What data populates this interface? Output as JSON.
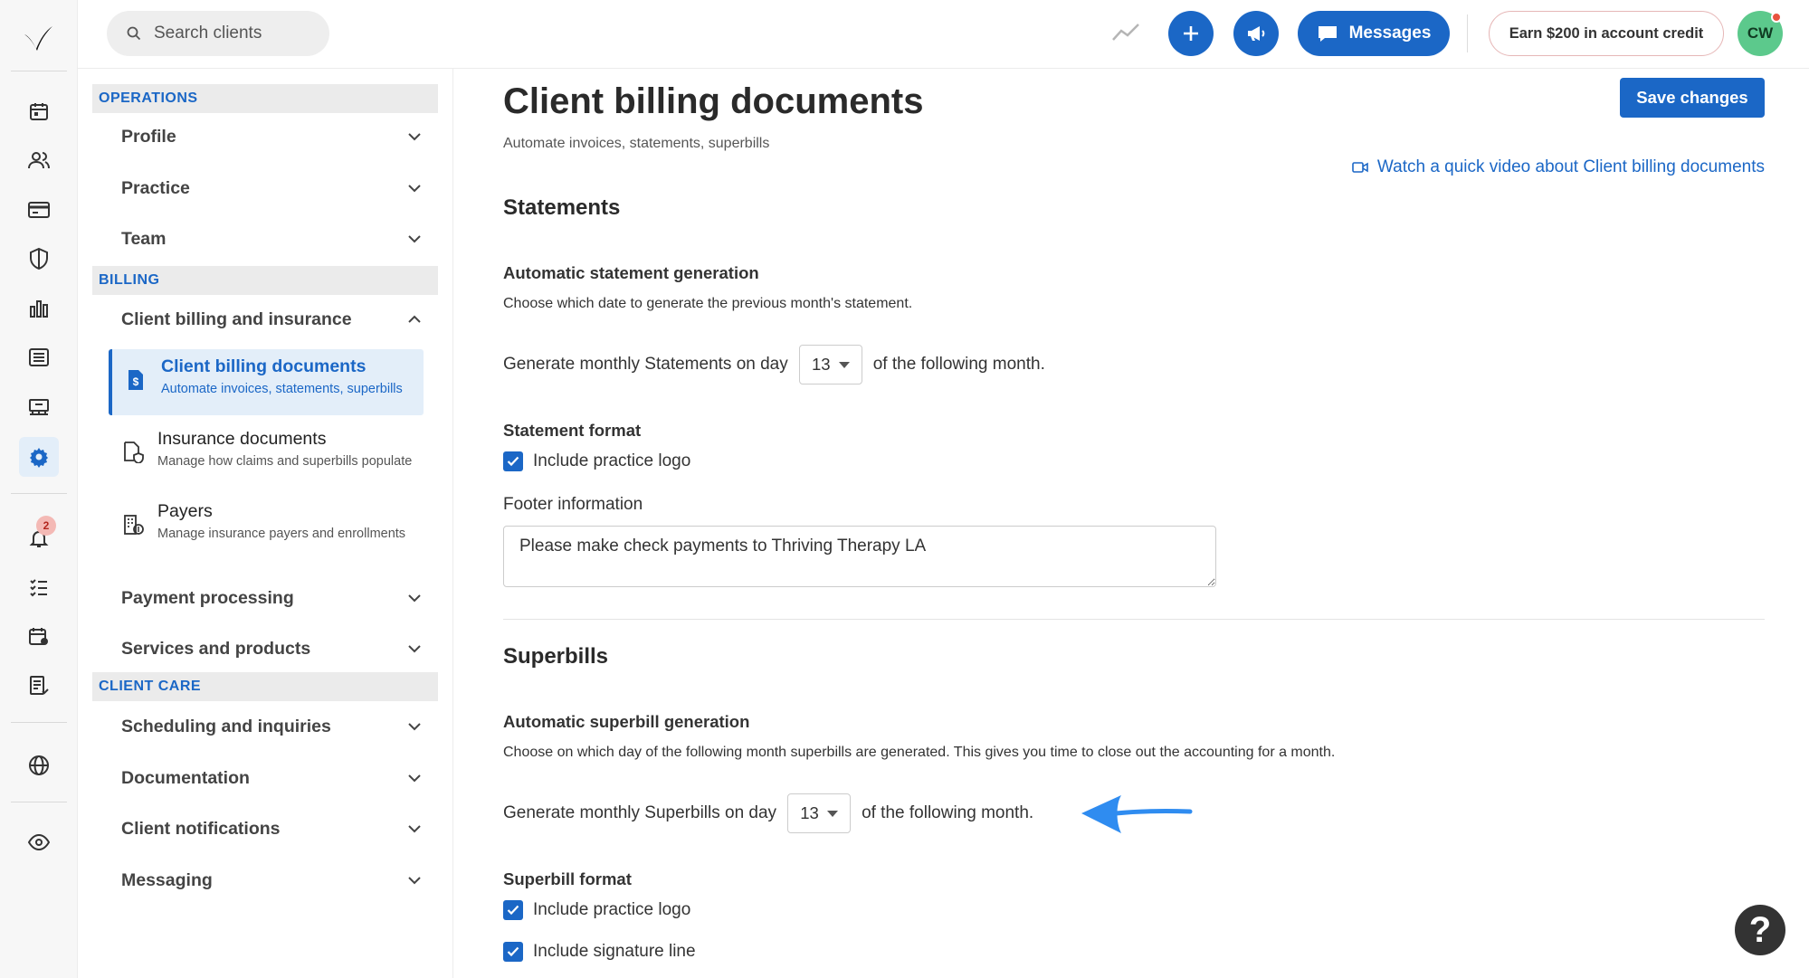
{
  "topbar": {
    "search_placeholder": "Search clients",
    "messages_label": "Messages",
    "earn_label": "Earn $200 in account credit",
    "avatar_initials": "CW"
  },
  "rail": {
    "icons": [
      "calendar-icon",
      "clients-icon",
      "billing-card-icon",
      "insurance-shield-icon",
      "analytics-icon",
      "activity-list-icon",
      "marketplace-icon",
      "settings-gear-icon",
      "notifications-bell-icon",
      "tasks-icon",
      "requests-icon",
      "reminders-icon",
      "website-globe-icon",
      "visibility-eye-icon"
    ],
    "notification_count": "2"
  },
  "nav": {
    "operations_header": "OPERATIONS",
    "billing_header": "BILLING",
    "client_care_header": "CLIENT CARE",
    "profile": "Profile",
    "practice": "Practice",
    "team": "Team",
    "client_billing_insurance": "Client billing and insurance",
    "sub_items": [
      {
        "title": "Client billing documents",
        "desc": "Automate invoices, statements, superbills"
      },
      {
        "title": "Insurance documents",
        "desc": "Manage how claims and superbills populate"
      },
      {
        "title": "Payers",
        "desc": "Manage insurance payers and enrollments"
      }
    ],
    "payment_processing": "Payment processing",
    "services_products": "Services and products",
    "scheduling_inquiries": "Scheduling and inquiries",
    "documentation": "Documentation",
    "client_notifications": "Client notifications",
    "messaging": "Messaging"
  },
  "main": {
    "title": "Client billing documents",
    "subtitle": "Automate invoices, statements, superbills",
    "save_label": "Save changes",
    "video_link": "Watch a quick video about Client billing documents",
    "statements": {
      "heading": "Statements",
      "auto_heading": "Automatic statement generation",
      "auto_desc": "Choose which date to generate the previous month's statement.",
      "generate_prefix": "Generate monthly Statements on day",
      "day_value": "13",
      "generate_suffix": "of the following month.",
      "format_heading": "Statement format",
      "include_logo": "Include practice logo",
      "footer_label": "Footer information",
      "footer_value": "Please make check payments to Thriving Therapy LA"
    },
    "superbills": {
      "heading": "Superbills",
      "auto_heading": "Automatic superbill generation",
      "auto_desc": "Choose on which day of the following month superbills are generated. This gives you time to close out the accounting for a month.",
      "generate_prefix": "Generate monthly Superbills on day",
      "day_value": "13",
      "generate_suffix": "of the following month.",
      "format_heading": "Superbill format",
      "include_logo": "Include practice logo",
      "include_signature": "Include signature line"
    }
  },
  "help_label": "?",
  "colors": {
    "accent": "#1b67c6",
    "active_bg": "#e3eef9",
    "arrow": "#2f8cf0"
  }
}
